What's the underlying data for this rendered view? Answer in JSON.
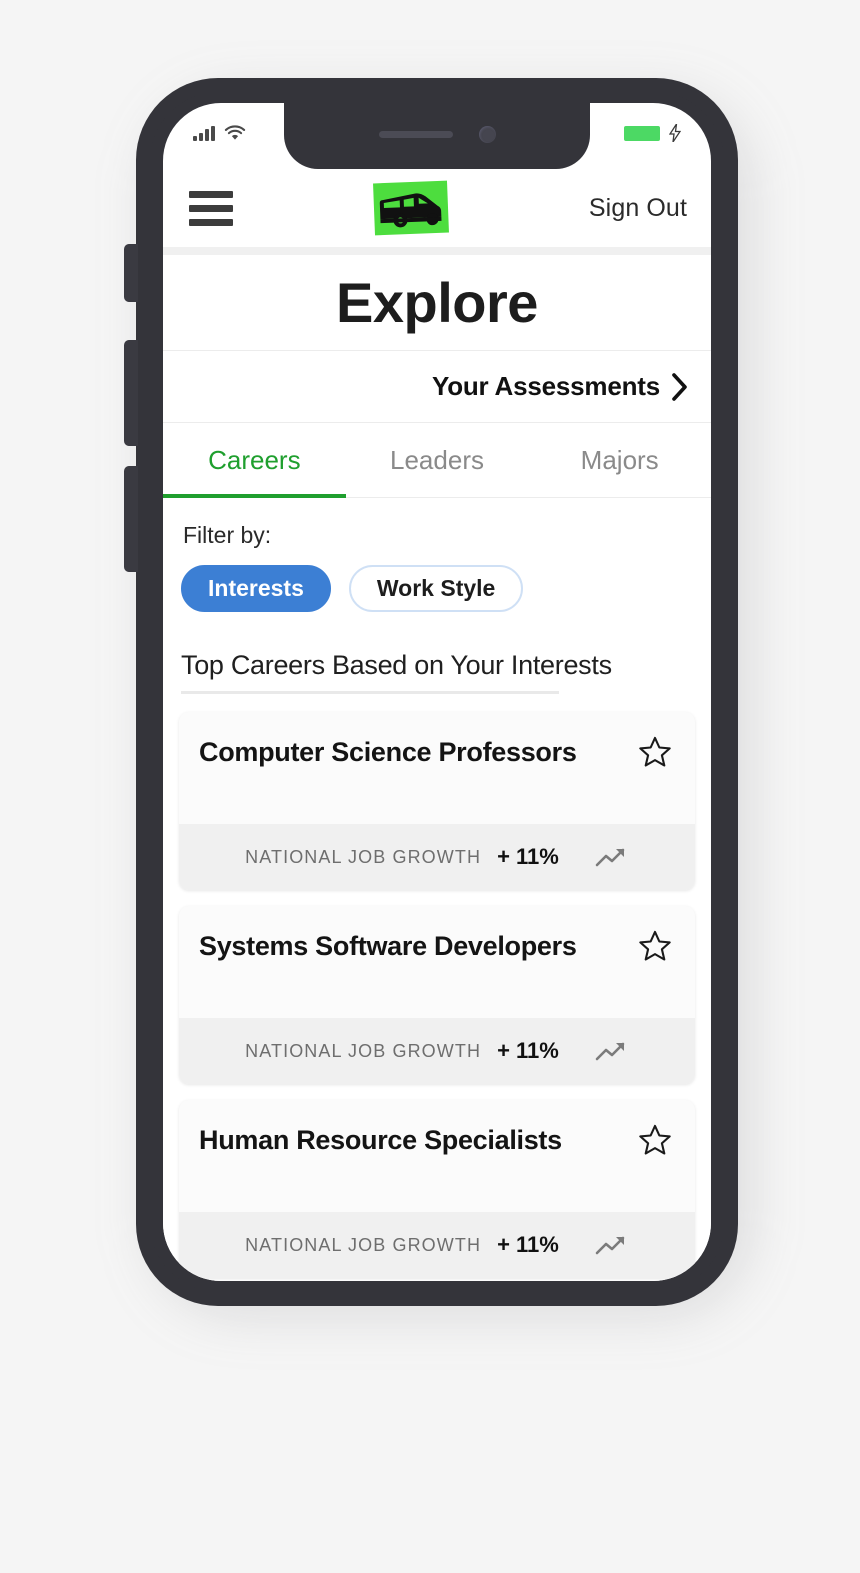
{
  "status_bar": {
    "signal_icon": "cellular-signal-icon",
    "signal_bars": 4,
    "wifi_icon": "wifi-icon",
    "battery_icon": "battery-icon",
    "battery_color": "#4cd964",
    "charging_icon": "charging-bolt-icon"
  },
  "header": {
    "menu_icon": "hamburger-menu-icon",
    "logo_icon": "van-logo-icon",
    "logo_color": "#4ddd3e",
    "sign_out_label": "Sign Out"
  },
  "page": {
    "title": "Explore"
  },
  "assessments": {
    "label": "Your Assessments",
    "chevron_icon": "chevron-right-icon"
  },
  "tabs": {
    "active_index": 0,
    "active_color": "#1f9f2e",
    "items": [
      {
        "label": "Careers",
        "active": true
      },
      {
        "label": "Leaders",
        "active": false
      },
      {
        "label": "Majors",
        "active": false
      }
    ]
  },
  "filter": {
    "label": "Filter by:",
    "selected_color": "#3c7fd4",
    "options": [
      {
        "label": "Interests",
        "selected": true
      },
      {
        "label": "Work Style",
        "selected": false
      }
    ]
  },
  "results": {
    "heading": "Top Careers Based on Your Interests",
    "cards": [
      {
        "title": "Computer Science Professors",
        "growth_label": "NATIONAL JOB GROWTH",
        "growth_value": "+ 11%",
        "star_icon": "star-outline-icon",
        "trend_icon": "trending-up-icon"
      },
      {
        "title": "Systems Software Developers",
        "growth_label": "NATIONAL JOB GROWTH",
        "growth_value": "+ 11%",
        "star_icon": "star-outline-icon",
        "trend_icon": "trending-up-icon"
      },
      {
        "title": "Human Resource Specialists",
        "growth_label": "NATIONAL JOB GROWTH",
        "growth_value": "+ 11%",
        "star_icon": "star-outline-icon",
        "trend_icon": "trending-up-icon"
      }
    ]
  }
}
